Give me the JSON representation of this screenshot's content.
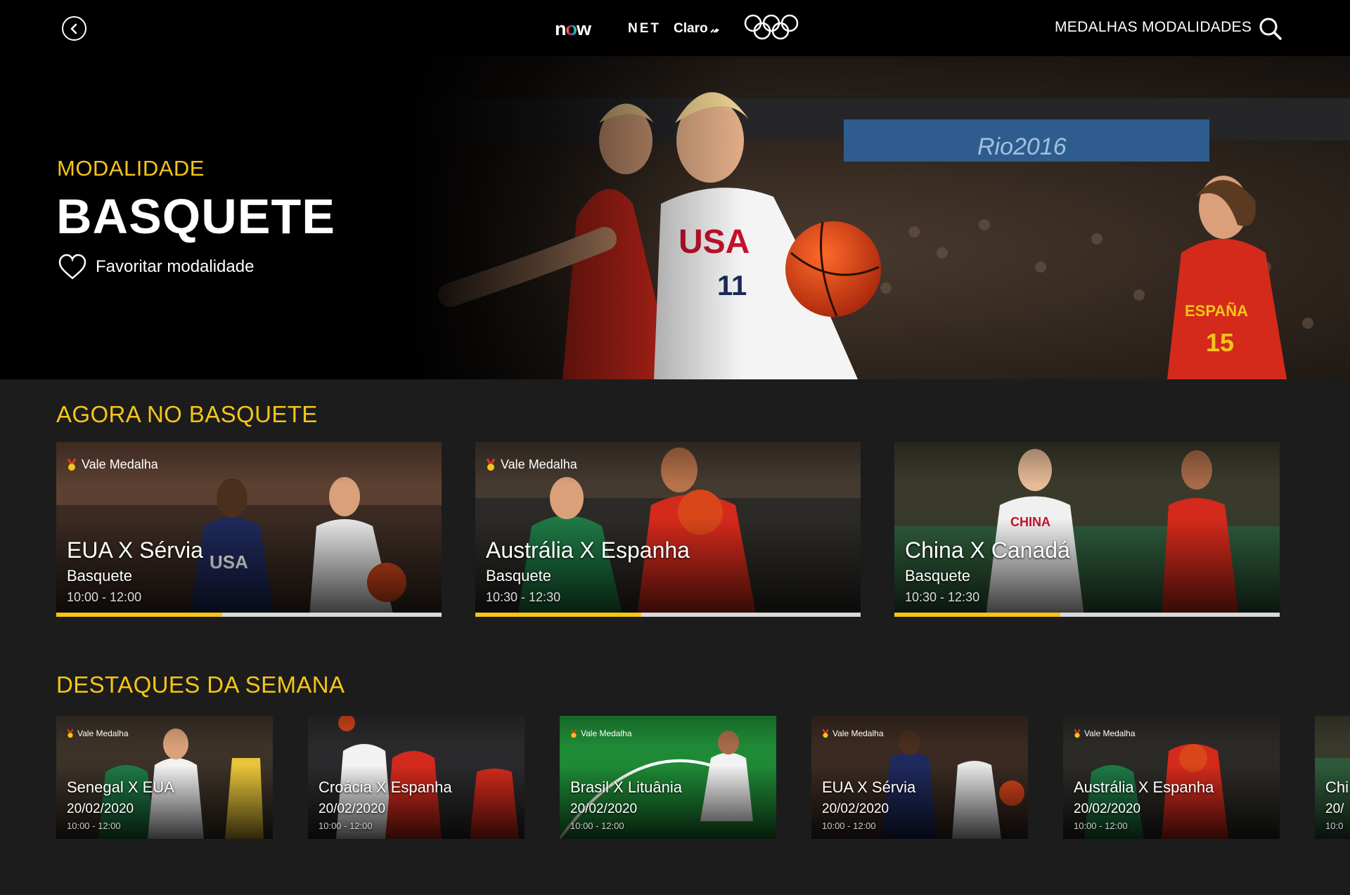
{
  "header": {
    "back_icon": "chevron-left-icon",
    "brand_now": "now",
    "brand_net": "NET",
    "brand_claro": "Claro",
    "brand_rings": "olympic-rings-logo",
    "nav": {
      "medalhas": "MEDALHAS",
      "modalidades": "MODALIDADES"
    },
    "search_icon": "search-icon"
  },
  "hero": {
    "eyebrow": "MODALIDADE",
    "title": "BASQUETE",
    "favorite_label": "Favoritar modalidade",
    "favorite_icon": "heart-outline-icon"
  },
  "colors": {
    "accent": "#f5c518",
    "background": "#1c1c1c",
    "topbar": "#000000",
    "progress_track": "#d9d9d9"
  },
  "sections": {
    "now": {
      "title": "AGORA NO BASQUETE",
      "cards": [
        {
          "badge": "Vale Medalha",
          "match": "EUA X Sérvia",
          "sport": "Basquete",
          "time": "10:00 - 12:00",
          "progress": 0.43
        },
        {
          "badge": "Vale Medalha",
          "match": "Austrália X Espanha",
          "sport": "Basquete",
          "time": "10:30 - 12:30",
          "progress": 0.43
        },
        {
          "badge": "",
          "match": "China X Canadá",
          "sport": "Basquete",
          "time": "10:30 - 12:30",
          "progress": 0.43
        }
      ]
    },
    "highlights": {
      "title": "DESTAQUES DA SEMANA",
      "cards": [
        {
          "badge": "Vale Medalha",
          "match": "Senegal X EUA",
          "date": "20/02/2020",
          "time": "10:00 - 12:00"
        },
        {
          "badge": "",
          "match": "Croácia X Espanha",
          "date": "20/02/2020",
          "time": "10:00 - 12:00"
        },
        {
          "badge": "Vale Medalha",
          "match": "Brasil X Lituânia",
          "date": "20/02/2020",
          "time": "10:00 - 12:00"
        },
        {
          "badge": "Vale Medalha",
          "match": "EUA X Sérvia",
          "date": "20/02/2020",
          "time": "10:00 - 12:00"
        },
        {
          "badge": "Vale Medalha",
          "match": "Austrália X Espanha",
          "date": "20/02/2020",
          "time": "10:00 - 12:00"
        },
        {
          "badge": "",
          "match": "Chi",
          "date": "20/",
          "time": "10:0"
        }
      ]
    }
  }
}
